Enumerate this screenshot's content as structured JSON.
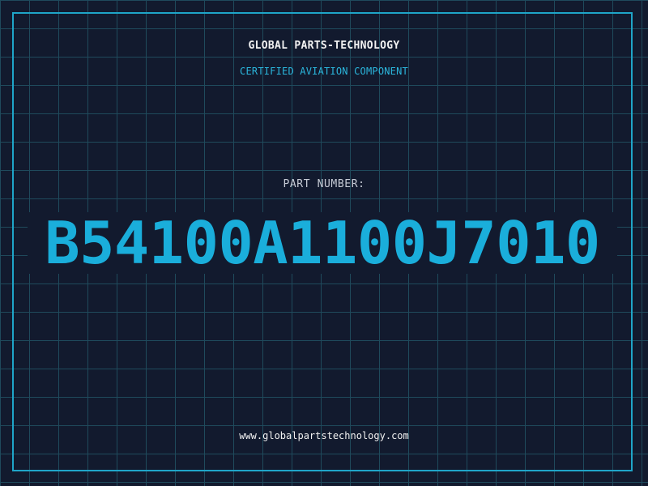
{
  "header": {
    "company_name": "GLOBAL PARTS-TECHNOLOGY",
    "subtitle": "CERTIFIED AVIATION COMPONENT"
  },
  "part": {
    "label": "PART NUMBER:",
    "number": "B54100A1100J7010"
  },
  "footer": {
    "website": "www.globalpartstechnology.com"
  },
  "colors": {
    "background": "#121a2e",
    "grid": "#1f4a5c",
    "accent": "#1aaedb",
    "text": "#f2f2f2"
  }
}
